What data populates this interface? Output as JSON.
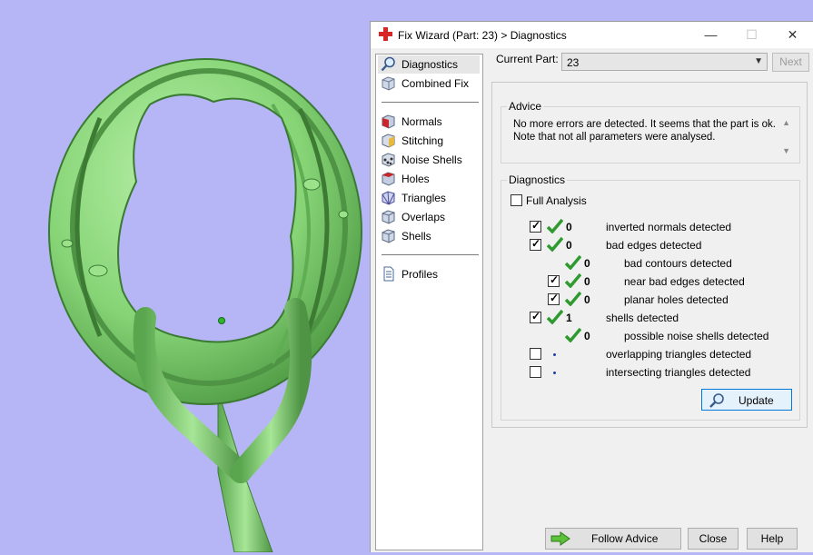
{
  "dialog": {
    "title": "Fix Wizard (Part: 23) > Diagnostics",
    "minimize_glyph": "—",
    "maximize_glyph": "☐",
    "close_glyph": "✕"
  },
  "nav": {
    "items": [
      {
        "label": "Diagnostics",
        "icon": "magnifier-icon"
      },
      {
        "label": "Combined Fix",
        "icon": "cube-icon"
      },
      {
        "label": "Normals",
        "icon": "normals-cube-icon"
      },
      {
        "label": "Stitching",
        "icon": "stitching-cube-icon"
      },
      {
        "label": "Noise Shells",
        "icon": "noise-cube-icon"
      },
      {
        "label": "Holes",
        "icon": "holes-cube-icon"
      },
      {
        "label": "Triangles",
        "icon": "triangles-cube-icon"
      },
      {
        "label": "Overlaps",
        "icon": "overlaps-cube-icon"
      },
      {
        "label": "Shells",
        "icon": "shells-cube-icon"
      },
      {
        "label": "Profiles",
        "icon": "document-icon"
      }
    ]
  },
  "part": {
    "label": "Current Part:",
    "value": "23",
    "next_label": "Next"
  },
  "advice": {
    "title": "Advice",
    "line1": "No more errors are detected. It seems that the part is ok.",
    "line2": "Note that not all parameters were analysed."
  },
  "diagnostics": {
    "title": "Diagnostics",
    "full_analysis_label": "Full Analysis",
    "rows": [
      {
        "count": "0",
        "label": "inverted normals detected"
      },
      {
        "count": "0",
        "label": "bad edges detected"
      },
      {
        "count": "0",
        "label": "bad contours detected"
      },
      {
        "count": "0",
        "label": "near bad edges detected"
      },
      {
        "count": "0",
        "label": "planar holes detected"
      },
      {
        "count": "1",
        "label": "shells detected"
      },
      {
        "count": "0",
        "label": "possible noise shells detected"
      },
      {
        "count": "",
        "label": "overlapping triangles detected"
      },
      {
        "count": "",
        "label": "intersecting triangles detected"
      }
    ],
    "update_label": "Update"
  },
  "buttons": {
    "follow_advice": "Follow Advice",
    "close": "Close",
    "help": "Help"
  },
  "colors": {
    "model_green": "#8fd97f",
    "viewport_bg": "#b6b5f6",
    "check_green": "#2f9a2f",
    "accent": "#0078d7"
  }
}
